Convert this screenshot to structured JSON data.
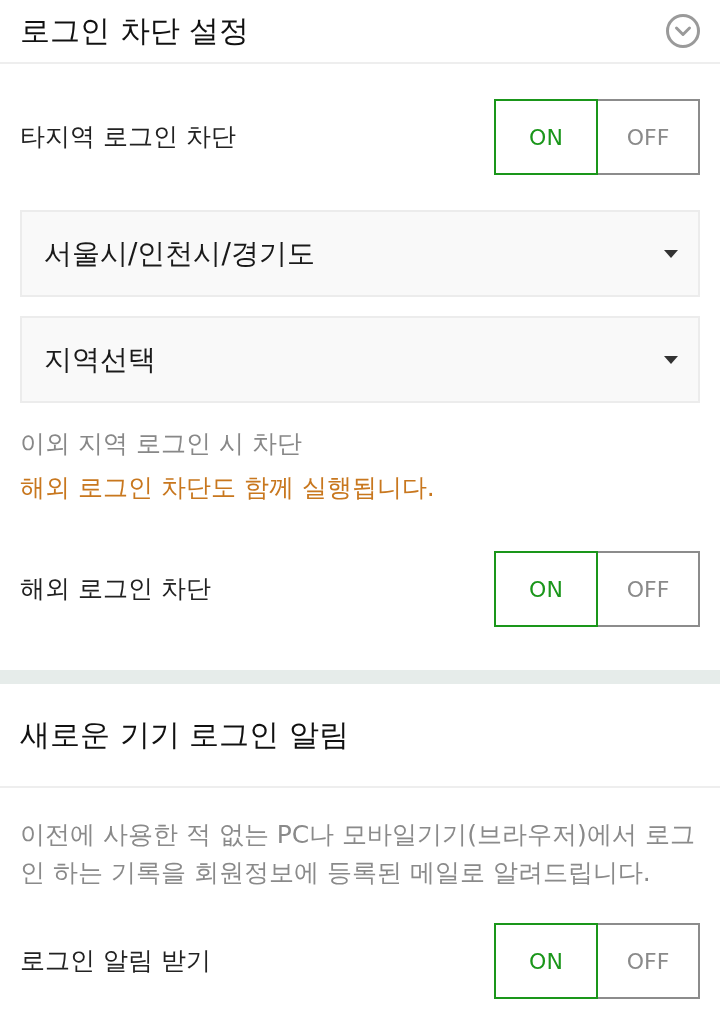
{
  "sections": [
    {
      "title": "로그인 차단 설정",
      "collapsible": true,
      "items": [
        {
          "kind": "toggle",
          "label": "타지역 로그인 차단",
          "options": [
            {
              "label": "ON",
              "selected": true
            },
            {
              "label": "OFF",
              "selected": false
            }
          ]
        },
        {
          "kind": "select",
          "value": "서울시/인천시/경기도"
        },
        {
          "kind": "select",
          "value": "지역선택"
        },
        {
          "kind": "note",
          "lines": [
            {
              "text": "이외 지역 로그인 시 차단",
              "color": "#888888"
            },
            {
              "text": "해외 로그인 차단도 함께 실행됩니다.",
              "color": "#c8771e"
            }
          ]
        },
        {
          "kind": "toggle",
          "label": "해외 로그인 차단",
          "options": [
            {
              "label": "ON",
              "selected": true
            },
            {
              "label": "OFF",
              "selected": false
            }
          ]
        }
      ]
    },
    {
      "title": "새로운 기기 로그인 알림",
      "collapsible": false,
      "items": [
        {
          "kind": "description",
          "text": "이전에 사용한 적 없는 PC나 모바일기기(브라우저)에서 로그인 하는 기록을 회원정보에 등록된 메일로 알려드립니다."
        },
        {
          "kind": "toggle",
          "label": "로그인 알림 받기",
          "options": [
            {
              "label": "ON",
              "selected": true
            },
            {
              "label": "OFF",
              "selected": false
            }
          ]
        }
      ]
    }
  ]
}
